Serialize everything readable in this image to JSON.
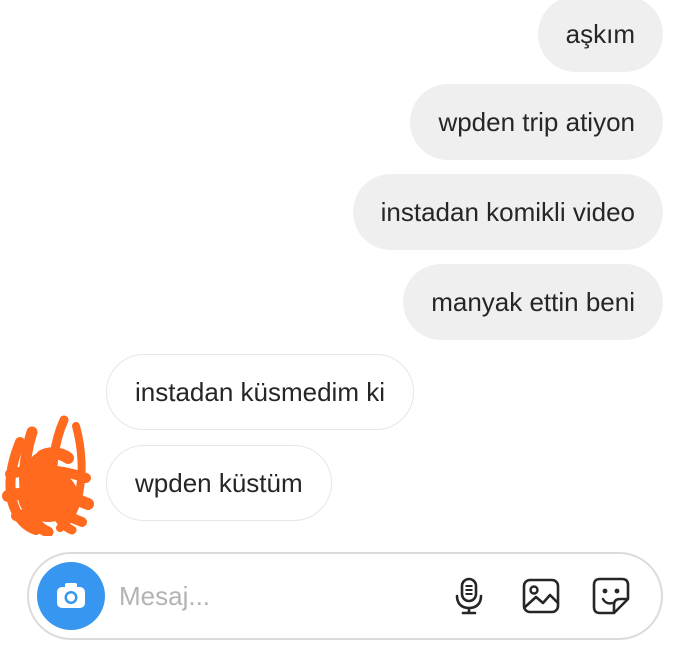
{
  "conversation": {
    "messages": [
      {
        "direction": "outgoing",
        "text": "aşkım"
      },
      {
        "direction": "outgoing",
        "text": "wpden trip atiyon"
      },
      {
        "direction": "outgoing",
        "text": "instadan komikli video"
      },
      {
        "direction": "outgoing",
        "text": "manyak ettin beni"
      },
      {
        "direction": "incoming",
        "text": "instadan küsmedim ki"
      },
      {
        "direction": "incoming",
        "text": "wpden küstüm"
      }
    ],
    "avatar_icon": "redacted-avatar-scribble"
  },
  "composer": {
    "placeholder": "Mesaj...",
    "value": "",
    "camera_icon": "camera-icon",
    "microphone_icon": "microphone-icon",
    "gallery_icon": "image-icon",
    "sticker_icon": "sticker-icon"
  },
  "colors": {
    "outgoing_bubble": "#efefef",
    "incoming_border": "#e6e6e6",
    "camera_button": "#3797f0",
    "avatar_scribble": "#ff6a1f"
  }
}
